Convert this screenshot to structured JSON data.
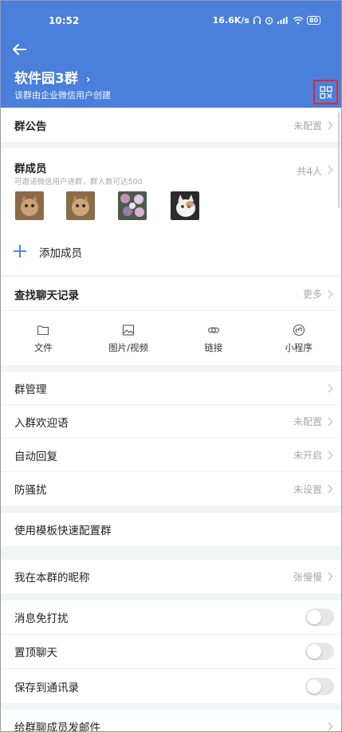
{
  "status_bar": {
    "time": "10:52",
    "net_speed": "16.6K/s",
    "battery": "80"
  },
  "header": {
    "title": "软件园3群",
    "title_chevron": "›",
    "subtitle": "该群由企业微信用户创建",
    "back_icon": "arrow-left-icon",
    "qr_icon": "qr-code-icon"
  },
  "announcement": {
    "label": "群公告",
    "value": "未配置"
  },
  "members": {
    "label": "群成员",
    "sub": "可邀请微信用户进群，群人数可达500",
    "value": "共4人",
    "add_label": "添加成员",
    "avatars": [
      "avatar-cat-brown",
      "avatar-cat-brown-2",
      "avatar-flowers",
      "avatar-cat-white"
    ]
  },
  "chat_history": {
    "label": "查找聊天记录",
    "value": "更多",
    "tools": [
      {
        "label": "文件",
        "icon": "folder-icon"
      },
      {
        "label": "图片/视频",
        "icon": "image-icon"
      },
      {
        "label": "链接",
        "icon": "link-icon"
      },
      {
        "label": "小程序",
        "icon": "mini-program-icon"
      }
    ]
  },
  "management": [
    {
      "label": "群管理",
      "value": ""
    },
    {
      "label": "入群欢迎语",
      "value": "未配置"
    },
    {
      "label": "自动回复",
      "value": "未开启"
    },
    {
      "label": "防骚扰",
      "value": "未设置"
    }
  ],
  "template": {
    "label": "使用模板快速配置群"
  },
  "nickname": {
    "label": "我在本群的昵称",
    "value": "张慢慢"
  },
  "toggles": [
    {
      "label": "消息免打扰",
      "on": false
    },
    {
      "label": "置顶聊天",
      "on": false
    },
    {
      "label": "保存到通讯录",
      "on": false
    }
  ],
  "email": {
    "label": "给群聊成员发邮件"
  },
  "colors": {
    "header_bg": "#4a7fdc",
    "accent": "#3a78e8",
    "highlight_box": "#e02a2a"
  }
}
